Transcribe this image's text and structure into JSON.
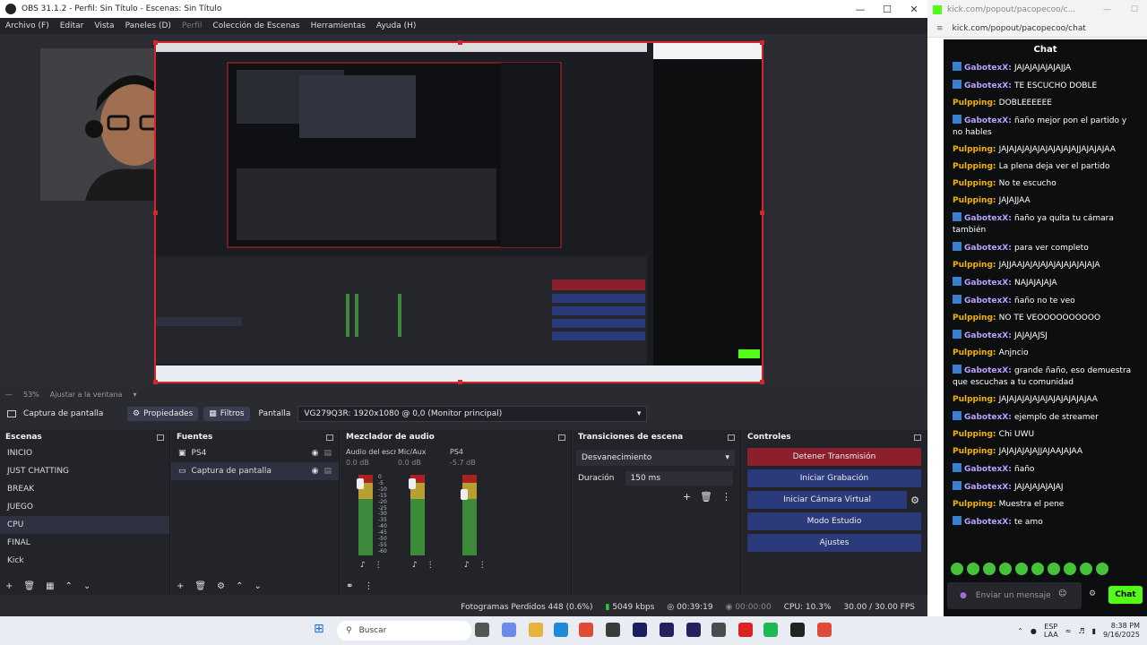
{
  "obs": {
    "title": "OBS 31.1.2 - Perfil: Sin Título - Escenas: Sin Título",
    "menu": [
      {
        "label": "Archivo (F)",
        "dim": false
      },
      {
        "label": "Editar",
        "dim": false
      },
      {
        "label": "Vista",
        "dim": false
      },
      {
        "label": "Paneles (D)",
        "dim": false
      },
      {
        "label": "Perfil",
        "dim": true
      },
      {
        "label": "Colección de Escenas",
        "dim": false
      },
      {
        "label": "Herramientas",
        "dim": false
      },
      {
        "label": "Ayuda (H)",
        "dim": false
      }
    ],
    "zoom": "53%",
    "fit_label": "Ajustar a la ventana",
    "source_name": "Captura de pantalla",
    "props_label": "Propiedades",
    "filters_label": "Filtros",
    "display_label": "Pantalla",
    "display_value": "VG279Q3R: 1920x1080 @ 0,0 (Monitor principal)",
    "scenes": {
      "title": "Escenas",
      "items": [
        "INICIO",
        "JUST CHATTING",
        "BREAK",
        "JUEGO",
        "CPU",
        "FINAL",
        "Kick"
      ],
      "selected": "CPU"
    },
    "sources": {
      "title": "Fuentes",
      "items": [
        "PS4",
        "Captura de pantalla"
      ]
    },
    "mixer": {
      "title": "Mezclador de audio",
      "channels": [
        {
          "name": "Audio del escritorio",
          "db": "0.0 dB"
        },
        {
          "name": "Mic/Aux",
          "db": "0.0 dB"
        },
        {
          "name": "PS4",
          "db": "-5.7 dB"
        }
      ],
      "scale": [
        "0",
        "-5",
        "-10",
        "-15",
        "-20",
        "-25",
        "-30",
        "-35",
        "-40",
        "-45",
        "-50",
        "-55",
        "-60"
      ]
    },
    "transitions": {
      "title": "Transiciones de escena",
      "selected": "Desvanecimiento",
      "duration_label": "Duración",
      "duration_value": "150 ms"
    },
    "controls": {
      "title": "Controles",
      "stop_stream": "Detener Transmisión",
      "start_record": "Iniciar Grabación",
      "start_vcam": "Iniciar Cámara Virtual",
      "studio_mode": "Modo Estudio",
      "settings": "Ajustes"
    },
    "status": {
      "dropped": "Fotogramas Perdidos 448 (0.6%)",
      "bitrate": "5049 kbps",
      "stream_time": "00:39:19",
      "rec_time": "00:00:00",
      "cpu": "CPU: 10.3%",
      "fps": "30.00 / 30.00 FPS"
    }
  },
  "browser": {
    "tab_url": "kick.com/popout/pacopecoo/c...",
    "url": "kick.com/popout/pacopecoo/chat",
    "chat_title": "Chat",
    "messages": [
      {
        "user": "GabotexX",
        "type": "g",
        "text": "JAJAJAJAJAJAJJA"
      },
      {
        "user": "GabotexX",
        "type": "g",
        "text": "TE ESCUCHO DOBLE"
      },
      {
        "user": "Pulpping",
        "type": "p",
        "text": "DOBLEEEEEE"
      },
      {
        "user": "GabotexX",
        "type": "g",
        "text": "ñaño mejor pon el partido y no hables"
      },
      {
        "user": "Pulpping",
        "type": "p",
        "text": "JAJAJAJAJAJAJAJAJAJAJJAJAJAJAA"
      },
      {
        "user": "Pulpping",
        "type": "p",
        "text": "La plena deja ver el partido"
      },
      {
        "user": "Pulpping",
        "type": "p",
        "text": "No te escucho"
      },
      {
        "user": "Pulpping",
        "type": "p",
        "text": "JAJAJJAA"
      },
      {
        "user": "GabotexX",
        "type": "g",
        "text": "ñaño ya quita tu cámara también"
      },
      {
        "user": "GabotexX",
        "type": "g",
        "text": "para ver completo"
      },
      {
        "user": "Pulpping",
        "type": "p",
        "text": "JAJJAAJAJAJAJAJAJAJAJAJAJA"
      },
      {
        "user": "GabotexX",
        "type": "g",
        "text": "NAJAJAJAJA"
      },
      {
        "user": "GabotexX",
        "type": "g",
        "text": "ñaño no te veo"
      },
      {
        "user": "Pulpping",
        "type": "p",
        "text": "NO TE VEOOOOOOOOOO"
      },
      {
        "user": "GabotexX",
        "type": "g",
        "text": "JAJAJAJSJ"
      },
      {
        "user": "Pulpping",
        "type": "p",
        "text": "Anjncio"
      },
      {
        "user": "GabotexX",
        "type": "g",
        "text": "grande ñaño, eso demuestra que escuchas a tu comunidad"
      },
      {
        "user": "Pulpping",
        "type": "p",
        "text": "JAJAJAJAJAJAJAJAJAJAJAJAA"
      },
      {
        "user": "GabotexX",
        "type": "g",
        "text": "ejemplo de streamer"
      },
      {
        "user": "Pulpping",
        "type": "p",
        "text": "Chi UWU"
      },
      {
        "user": "Pulpping",
        "type": "p",
        "text": "JAJAJAJAJAJJAJAAJAJAA"
      },
      {
        "user": "GabotexX",
        "type": "g",
        "text": "ñaño"
      },
      {
        "user": "GabotexX",
        "type": "g",
        "text": "JAJAJAJAJAJAJ"
      },
      {
        "user": "Pulpping",
        "type": "p",
        "text": "Muestra el pene"
      },
      {
        "user": "GabotexX",
        "type": "g",
        "text": "te amo"
      }
    ],
    "input_placeholder": "Enviar un mensaje",
    "send_label": "Chat"
  },
  "taskbar": {
    "search_placeholder": "Buscar",
    "lang": "ESP",
    "lang2": "LAA",
    "time": "8:38 PM",
    "date": "9/16/2025"
  }
}
